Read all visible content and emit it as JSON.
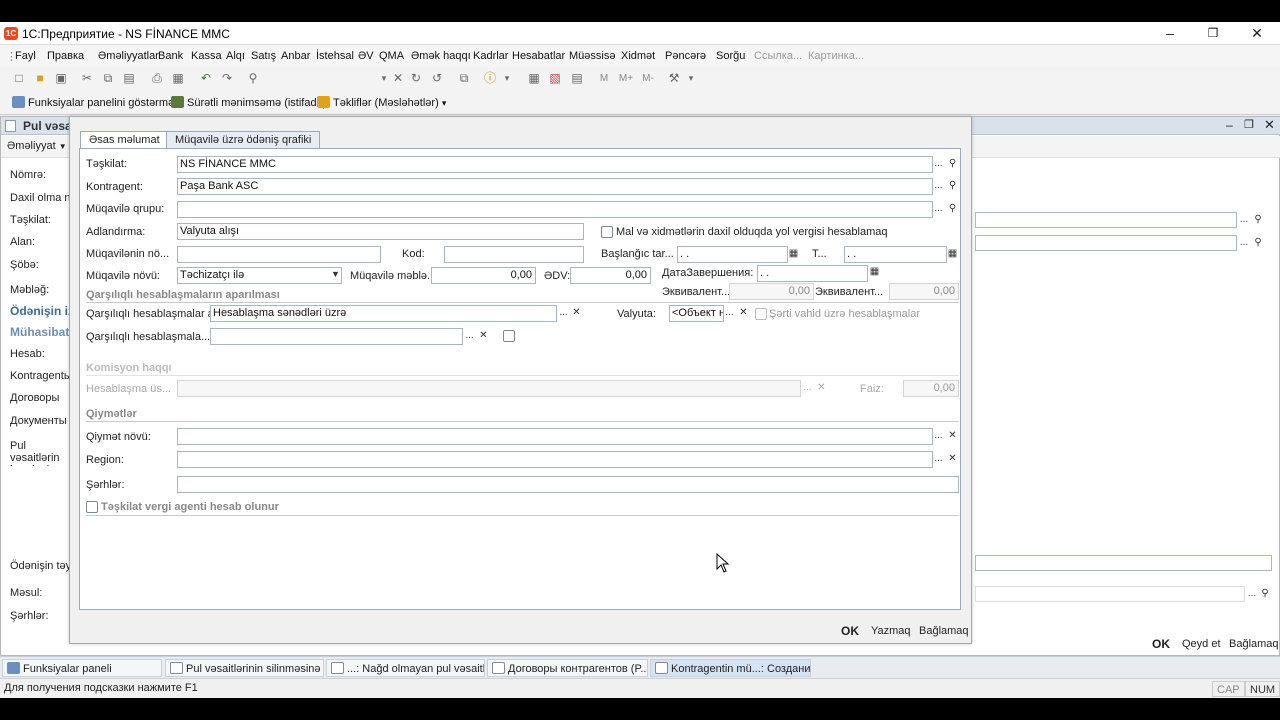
{
  "window": {
    "title": "1С:Предприятие - NS FİNANCE MMC"
  },
  "menu": [
    "Fayl",
    "Правка",
    "Əməliyyatlar",
    "Bank",
    "Kassa",
    "Alqı",
    "Satış",
    "Anbar",
    "İstehsal",
    "ƏV",
    "QMA",
    "Əmək haqqı",
    "Kadrlar",
    "Hesabatlar",
    "Müəssisə",
    "Xidmət",
    "Pəncərə",
    "Sorğu",
    "Ссылка...",
    "Картинка..."
  ],
  "toolbar2": {
    "func_panel": "Funksiyalar panelini göstərmək",
    "quick": "Sürətli mənimsəmə (istifadə)",
    "tips": "Təkliflər (Məsləhətlər)"
  },
  "back": {
    "title": "Pul vəsaiti",
    "op_btn": "Əməliyyat",
    "labels": [
      "Nömrə:",
      "Daxil olma nö",
      "Təşkilat:",
      "Alan:",
      "Şöbə:",
      "Məbləğ:",
      "Ödənişin iz",
      "Mühasibat",
      "Hesab:",
      "Kontragentь",
      "Договоры",
      "Документы",
      "Pul vəsaitlərin hərəkəti madd",
      "Ödənişin təyin",
      "Məsul:",
      "Şərhlər:"
    ],
    "ok": "OK",
    "save": "Qeyd et",
    "close": "Bağlamaq"
  },
  "dialog": {
    "tabs": [
      "Əsas məlumat",
      "Müqavilə üzrə ödəniş qrafiki"
    ],
    "org_label": "Təşkilat:",
    "org_value": "NS FİNANCE MMC",
    "contr_label": "Kontragent:",
    "contr_value": "Paşa Bank ASC",
    "group_label": "Müqavilə qrupu:",
    "name_label": "Adlandırma:",
    "name_value": "Valyuta alışı",
    "vat_check": "Mal və xidmətlərin daxil olduqda yol vergisi hesablamaq",
    "num_label": "Müqavilənin nö...",
    "code_label": "Kod:",
    "start_label": "Başlanğıc tar...",
    "start_value": " .  .",
    "t_label": "T...",
    "t_value": " .  .",
    "type_label": "Müqavilə növü:",
    "type_value": "Təchizatçı ilə",
    "amount_label": "Müqavilə məblə...",
    "amount_value": "0,00",
    "edv_label": "ƏDV:",
    "edv_value": "0,00",
    "end_label": "ДатаЗавершения:",
    "end_value": " .  .",
    "eq1_label": "Эквивалент...",
    "eq1_value": "0,00",
    "eq2_label": "Эквивалент...",
    "eq2_value": "0,00",
    "settle_section": "Qarşılıqlı hesablaşmaların aparılması",
    "settle_label": "Qarşılıqlı hesablaşmalar ap...",
    "settle_value": "Hesablaşma sənədləri üzrə",
    "currency_label": "Valyuta:",
    "currency_value": "<Объект н",
    "cond_unit": "Şərti vahid üzrə hesablaşmalar",
    "settle2_label": "Qarşılıqlı hesablaşmala...",
    "commission_section": "Komisyon haqqı",
    "calc_label": "Hesablaşma üs...",
    "rate_label": "Faiz:",
    "rate_value": "0,00",
    "prices_section": "Qiymətlər",
    "price_type_label": "Qiymət növü:",
    "region_label": "Region:",
    "comments_label": "Şərhlər:",
    "tax_agent": "Təşkilat vergi agenti hesab olunur",
    "ok": "OK",
    "write": "Yazmaq",
    "close": "Bağlamaq"
  },
  "taskbar": [
    "Funksiyalar paneli",
    "Pul vəsaitlərinin silinməsinə öd...",
    "...: Nağd olmayan pul vəsaitlə...",
    "Договоры контрагентов (P...",
    "Kontragentin mü...: Создание *"
  ],
  "status": {
    "hint": "Для получения подсказки нажмите F1",
    "cap": "CAP",
    "num": "NUM"
  }
}
